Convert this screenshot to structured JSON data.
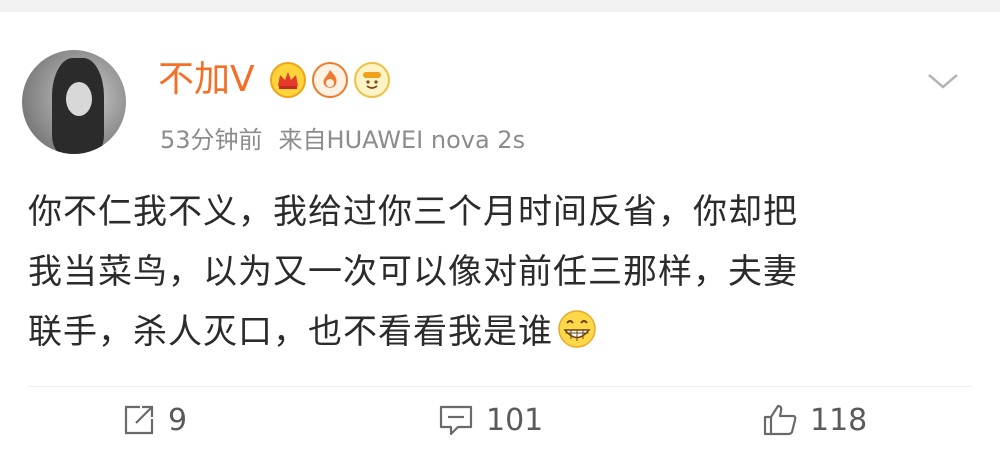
{
  "post": {
    "username": "不加V",
    "badges": [
      "crown-badge-icon",
      "flame-badge-icon",
      "face-badge-icon"
    ],
    "time": "53分钟前",
    "source": "来自HUAWEI nova 2s",
    "text_lines": [
      "你不仁我不义，我给过你三个月时间反省，你却把",
      "我当菜鸟，以为又一次可以像对前任三那样，夫妻",
      "联手，杀人灭口，也不看看我是谁"
    ],
    "end_emoji": "grinning-face-icon"
  },
  "actions": {
    "repost_count": "9",
    "comment_count": "101",
    "like_count": "118"
  },
  "colors": {
    "username": "#f56f26",
    "meta": "#8c8c8c",
    "text": "#2b2b2b",
    "background": "#f2f2f2"
  }
}
